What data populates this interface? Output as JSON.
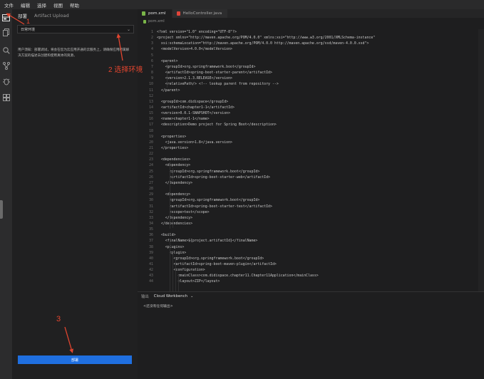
{
  "menu": [
    "文件",
    "编辑",
    "选择",
    "视图",
    "帮助"
  ],
  "activity_bar": {
    "icons": [
      "deploy-icon",
      "files-icon",
      "search-icon",
      "source-control-icon",
      "debug-icon",
      "extensions-icon"
    ]
  },
  "panel": {
    "tabs": [
      "部署",
      "Artifact Upload"
    ],
    "env_select": {
      "value": "日常环境"
    },
    "notice": "用户须知：部署调试，将会在您为云应用开通的云服务上，请确保应用所属解决方案的描述去创建和使用真体的资源。",
    "deploy_button": "部署"
  },
  "editor": {
    "tabs": [
      {
        "name": "pom.xml",
        "icon_color": "#7ab648"
      },
      {
        "name": "HelloController.java",
        "icon_color": "#e0453a"
      }
    ],
    "breadcrumb": "pom.xml",
    "lines": [
      {
        "n": "1",
        "t": "<?xml version=\"1.0\" encoding=\"UTF-8\"?>"
      },
      {
        "n": "2",
        "t": "<project xmlns=\"http://maven.apache.org/POM/4.0.0\" xmlns:xsi=\"http://www.w3.org/2001/XMLSchema-instance\""
      },
      {
        "n": "3",
        "t": "  xsi:schemaLocation=\"http://maven.apache.org/POM/4.0.0 http://maven.apache.org/xsd/maven-4.0.0.xsd\">"
      },
      {
        "n": "4",
        "t": "  <modelVersion>4.0.0</modelVersion>"
      },
      {
        "n": "5",
        "t": ""
      },
      {
        "n": "6",
        "t": "  <parent>"
      },
      {
        "n": "7",
        "t": "    <groupId>org.springframework.boot</groupId>"
      },
      {
        "n": "8",
        "t": "    <artifactId>spring-boot-starter-parent</artifactId>"
      },
      {
        "n": "9",
        "t": "    <version>2.1.3.RELEASE</version>"
      },
      {
        "n": "10",
        "t": "    <relativePath/> <!-- lookup parent from repository -->"
      },
      {
        "n": "11",
        "t": "  </parent>"
      },
      {
        "n": "12",
        "t": ""
      },
      {
        "n": "13",
        "t": "  <groupId>com.didispace</groupId>"
      },
      {
        "n": "14",
        "t": "  <artifactId>chapter1-1</artifactId>"
      },
      {
        "n": "15",
        "t": "  <version>0.0.1-SNAPSHOT</version>"
      },
      {
        "n": "16",
        "t": "  <name>chapter1-1</name>"
      },
      {
        "n": "17",
        "t": "  <description>Demo project for Spring Boot</description>"
      },
      {
        "n": "18",
        "t": ""
      },
      {
        "n": "19",
        "t": "  <properties>"
      },
      {
        "n": "20",
        "t": "    <java.version>1.8</java.version>"
      },
      {
        "n": "21",
        "t": "  </properties>"
      },
      {
        "n": "22",
        "t": ""
      },
      {
        "n": "23",
        "t": "  <dependencies>"
      },
      {
        "n": "24",
        "t": "    <dependency>"
      },
      {
        "n": "25",
        "t": "      <groupId>org.springframework.boot</groupId>"
      },
      {
        "n": "26",
        "t": "      <artifactId>spring-boot-starter-web</artifactId>"
      },
      {
        "n": "27",
        "t": "    </dependency>"
      },
      {
        "n": "28",
        "t": ""
      },
      {
        "n": "29",
        "t": "    <dependency>"
      },
      {
        "n": "30",
        "t": "      <groupId>org.springframework.boot</groupId>"
      },
      {
        "n": "31",
        "t": "      <artifactId>spring-boot-starter-test</artifactId>"
      },
      {
        "n": "32",
        "t": "      <scope>test</scope>"
      },
      {
        "n": "33",
        "t": "    </dependency>"
      },
      {
        "n": "34",
        "t": "  </dependencies>"
      },
      {
        "n": "35",
        "t": ""
      },
      {
        "n": "36",
        "t": "  <build>"
      },
      {
        "n": "37",
        "t": "    <finalName>${project.artifactId}</finalName>"
      },
      {
        "n": "38",
        "t": "    <plugins>"
      },
      {
        "n": "39",
        "t": "      <plugin>"
      },
      {
        "n": "40",
        "t": "        <groupId>org.springframework.boot</groupId>"
      },
      {
        "n": "41",
        "t": "        <artifactId>spring-boot-maven-plugin</artifactId>"
      },
      {
        "n": "42",
        "t": "        <configuration>"
      },
      {
        "n": "43",
        "t": "          <mainClass>com.didispace.chapter11.Chapter11Application</mainClass>"
      },
      {
        "n": "44",
        "t": "          <layout>ZIP</layout>"
      }
    ]
  },
  "output": {
    "tabs": [
      "输出",
      "Cloud Workbench"
    ],
    "message": "<还没有任何输出>"
  },
  "annotations": {
    "step1": "1",
    "step2": "2 选择环境",
    "step3": "3",
    "color": "#e2452f"
  }
}
